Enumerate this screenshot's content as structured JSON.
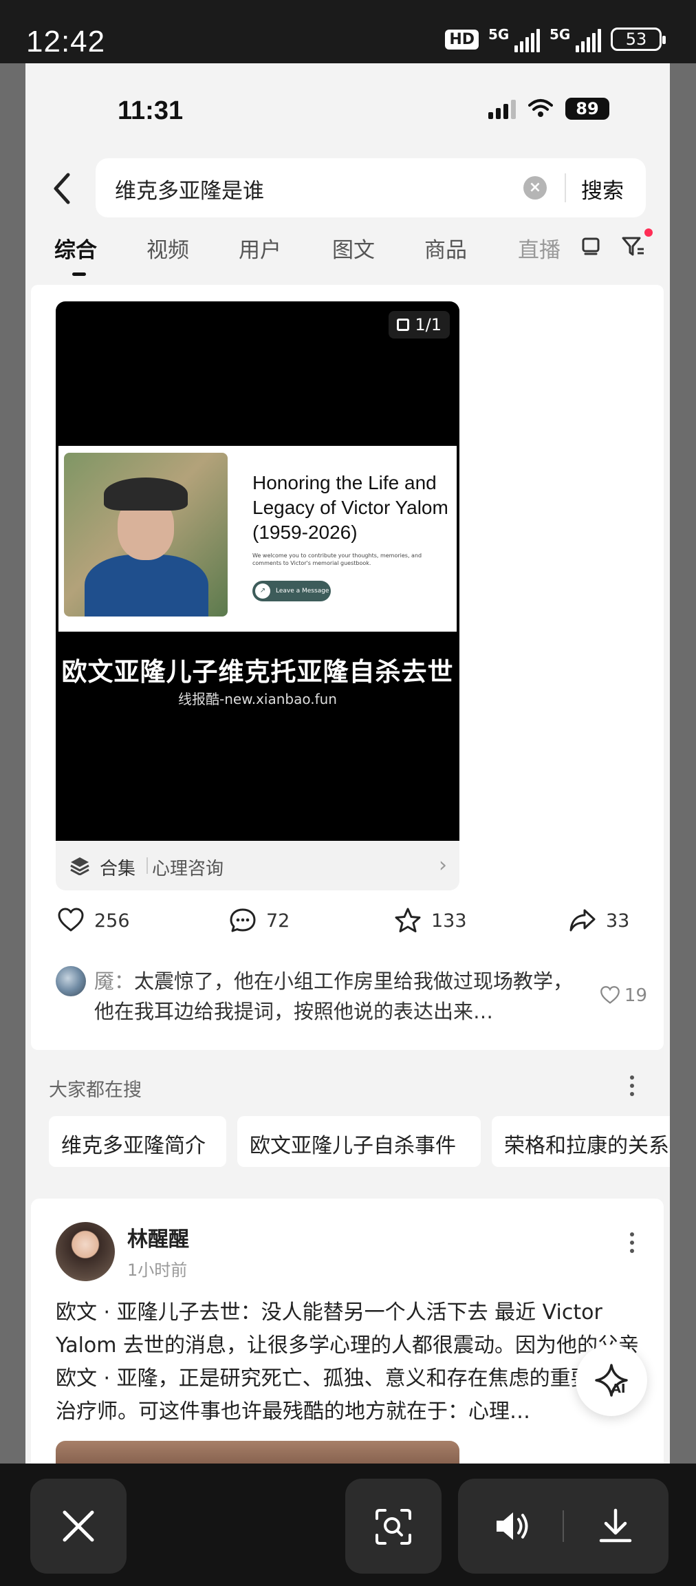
{
  "outer_status": {
    "time": "12:42",
    "hd": "HD",
    "net1": "5G",
    "net2": "5G",
    "battery": "53"
  },
  "inner_status": {
    "time": "11:31",
    "battery": "89"
  },
  "search": {
    "query": "维克多亚隆是谁",
    "button": "搜索"
  },
  "tabs": [
    "综合",
    "视频",
    "用户",
    "图文",
    "商品",
    "直播"
  ],
  "card": {
    "page_indicator": "1/1",
    "memorial_title": "Honoring the Life and Legacy of Victor Yalom (1959-2026)",
    "memorial_subtitle": "We welcome you to contribute your thoughts, memories, and comments to Victor's memorial guestbook.",
    "memorial_button": "Leave a Message",
    "headline": "欧文亚隆儿子维克托亚隆自杀去世",
    "watermark": "线报酷-new.xianbao.fun",
    "collection_label": "合集",
    "collection_name": "心理咨询",
    "likes": "256",
    "comments": "72",
    "favorites": "133",
    "shares": "33",
    "top_comment": {
      "author": "魇：",
      "text": "太震惊了，他在小组工作房里给我做过现场教学，他在我耳边给我提词，按照他说的表达出来…",
      "likes": "19"
    }
  },
  "popular": {
    "title": "大家都在搜",
    "chips": [
      "维克多亚隆简介",
      "欧文亚隆儿子自杀事件",
      "荣格和拉康的关系"
    ]
  },
  "post": {
    "author": "林醒醒",
    "time": "1小时前",
    "body": "欧文 · 亚隆儿子去世：没人能替另一个人活下去 最近 Victor Yalom 去世的消息，让很多学心理的人都很震动。因为他的父亲欧文 · 亚隆，正是研究死亡、孤独、意义和存在焦虑的重要心理治疗师。可这件事也许最残酷的地方就在于：心理…"
  },
  "ai_label": "AI",
  "colors": {
    "accent_red": "#ff2d55",
    "background": "#f3f3f3"
  }
}
